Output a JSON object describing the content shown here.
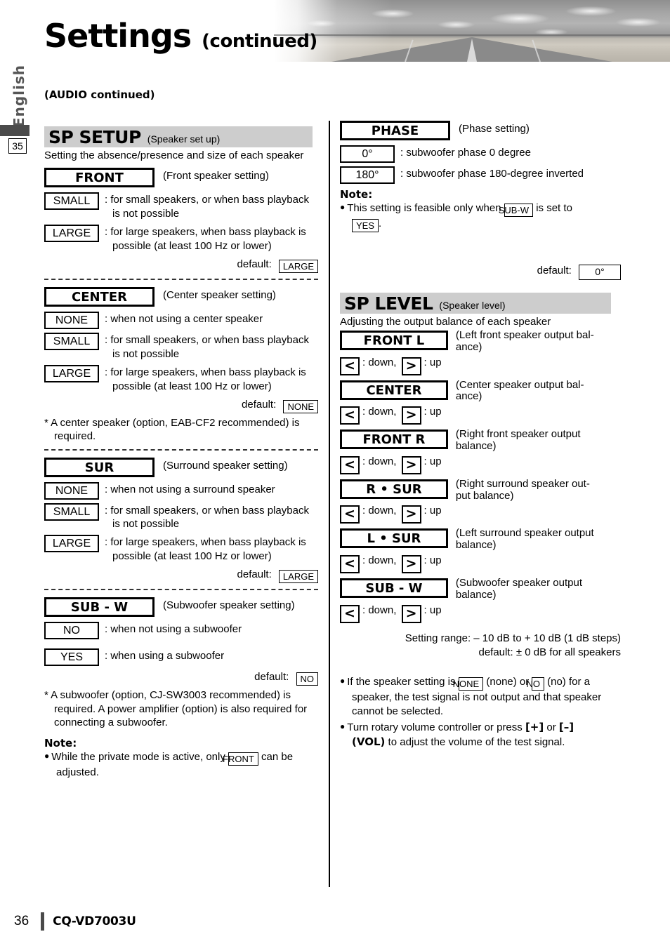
{
  "header": {
    "title": "Settings",
    "title_suffix": "(continued)",
    "language_tab": "English",
    "prev_page_marker": "35",
    "banner_image": "desert-road-photo"
  },
  "subheading": "(AUDIO continued)",
  "left_column": {
    "section": {
      "name": "SP SETUP",
      "subtitle": "(Speaker set up)",
      "description": "Setting the absence/presence and size of each speaker"
    },
    "settings": [
      {
        "label": "FRONT",
        "paren": "(Front speaker setting)",
        "options": [
          {
            "box": "SMALL",
            "text": ": for small speakers, or when bass playback",
            "text2": "is not possible"
          },
          {
            "box": "LARGE",
            "text": ": for large speakers, when bass playback is",
            "text2": "possible (at least 100 Hz or lower)"
          }
        ],
        "default_label": "default:",
        "default_value": "LARGE",
        "star_note": ""
      },
      {
        "label": "CENTER",
        "paren": "(Center speaker setting)",
        "options": [
          {
            "box": "NONE",
            "text": ": when not using a center speaker",
            "text2": ""
          },
          {
            "box": "SMALL",
            "text": ": for small speakers, or when bass playback",
            "text2": "is not possible"
          },
          {
            "box": "LARGE",
            "text": ": for large speakers, when bass playback is",
            "text2": "possible (at least 100 Hz or lower)"
          }
        ],
        "default_label": "default:",
        "default_value": "NONE",
        "star_note": "* A center speaker (option, EAB-CF2 recommended) is required."
      },
      {
        "label": "SUR",
        "paren": "(Surround speaker setting)",
        "options": [
          {
            "box": "NONE",
            "text": ": when not using a surround speaker",
            "text2": ""
          },
          {
            "box": "SMALL",
            "text": ": for small speakers, or when bass playback",
            "text2": "is not possible"
          },
          {
            "box": "LARGE",
            "text": ": for large speakers, when bass playback is",
            "text2": "possible (at least 100 Hz or lower)"
          }
        ],
        "default_label": "default:",
        "default_value": "LARGE",
        "star_note": ""
      },
      {
        "label": "SUB - W",
        "paren": "(Subwoofer speaker setting)",
        "options": [
          {
            "box": "NO",
            "text": ": when not using a subwoofer",
            "text2": ""
          },
          {
            "box": "YES",
            "text": ": when using a subwoofer",
            "text2": ""
          }
        ],
        "default_label": "default:",
        "default_value": "NO",
        "star_note": "* A subwoofer (option, CJ-SW3003 recommended) is required. A power amplifier (option) is also required for connecting a subwoofer."
      }
    ],
    "note": {
      "heading": "Note:",
      "bullet_part1": "While the private mode is active, only",
      "bullet_box": "FRONT",
      "bullet_part2": "can be",
      "bullet_line2": "adjusted."
    }
  },
  "right_column": {
    "phase": {
      "label": "PHASE",
      "paren": "(Phase setting)",
      "options": [
        {
          "box": "0°",
          "text": ": subwoofer phase 0 degree"
        },
        {
          "box": "180°",
          "text": ": subwoofer phase 180-degree inverted"
        }
      ],
      "note_heading": "Note:",
      "note_part1": "This setting is feasible only when",
      "note_box1": "SUB-W",
      "note_part2": "is set to",
      "note_box2": "YES",
      "note_part3": ".",
      "default_label": "default:",
      "default_value": "0°"
    },
    "sp_level": {
      "section": {
        "name": "SP LEVEL",
        "subtitle": "(Speaker level)",
        "description": "Adjusting the output balance of each speaker"
      },
      "arrow_down_icon": "<",
      "arrow_up_icon": ">",
      "down_label": ": down,",
      "up_label": ": up",
      "items": [
        {
          "label": "FRONT L",
          "desc_line1": "(Left front speaker output bal-",
          "desc_line2": "ance)"
        },
        {
          "label": "CENTER",
          "desc_line1": "(Center speaker output bal-",
          "desc_line2": "ance)"
        },
        {
          "label": "FRONT R",
          "desc_line1": "(Right front speaker output",
          "desc_line2": "balance)"
        },
        {
          "label": "R • SUR",
          "desc_line1": "(Right surround speaker out-",
          "desc_line2": "put balance)"
        },
        {
          "label": "L • SUR",
          "desc_line1": "(Left surround speaker output",
          "desc_line2": "balance)"
        },
        {
          "label": "SUB - W",
          "desc_line1": "(Subwoofer speaker output",
          "desc_line2": "balance)"
        }
      ],
      "range_line1": "Setting range: – 10 dB to + 10 dB (1 dB steps)",
      "range_line2": "default: ± 0 dB for all speakers",
      "notes": [
        {
          "part1": "If the speaker setting is",
          "box1": "NONE",
          "part2": "(none) or",
          "box2": "NO",
          "part3": "(no) for a",
          "line2": "speaker, the test signal is not output and that speaker",
          "line3": "cannot be selected."
        },
        {
          "part1": "Turn rotary volume controller or press",
          "bold1": "[+]",
          "mid": "or",
          "bold2": "[–]",
          "bold3": "(VOL)",
          "line2_rest": "to adjust the volume of the test signal."
        }
      ]
    }
  },
  "footer": {
    "page_number": "36",
    "model": "CQ-VD7003U"
  },
  "colors": {
    "section_band": "#cdcdcd",
    "tab_dark": "#4a4a4a",
    "text": "#000000"
  }
}
